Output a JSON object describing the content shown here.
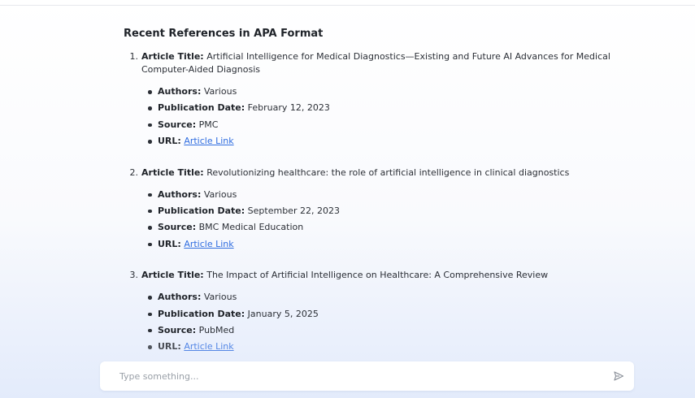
{
  "heading": "Recent References in APA Format",
  "labels": {
    "article_title": "Article Title:",
    "authors": "Authors:",
    "publication_date": "Publication Date:",
    "source": "Source:",
    "url": "URL:"
  },
  "references": [
    {
      "number": "1.",
      "title": "Artificial Intelligence for Medical Diagnostics—Existing and Future AI Advances for Medical Computer-Aided Diagnosis",
      "authors": "Various",
      "publication_date": "February 12, 2023",
      "source": "PMC",
      "url_text": "Article Link"
    },
    {
      "number": "2.",
      "title": "Revolutionizing healthcare: the role of artificial intelligence in clinical diagnostics",
      "authors": "Various",
      "publication_date": "September 22, 2023",
      "source": "BMC Medical Education",
      "url_text": "Article Link"
    },
    {
      "number": "3.",
      "title": "The Impact of Artificial Intelligence on Healthcare: A Comprehensive Review",
      "authors": "Various",
      "publication_date": "January 5, 2025",
      "source": "PubMed",
      "url_text": "Article Link"
    }
  ],
  "input": {
    "placeholder": "Type something...",
    "value": ""
  },
  "icons": {
    "send": "send-icon"
  },
  "colors": {
    "link": "#2f6de0",
    "text": "#2b2f36",
    "background_bottom": "#e3ebfb"
  }
}
